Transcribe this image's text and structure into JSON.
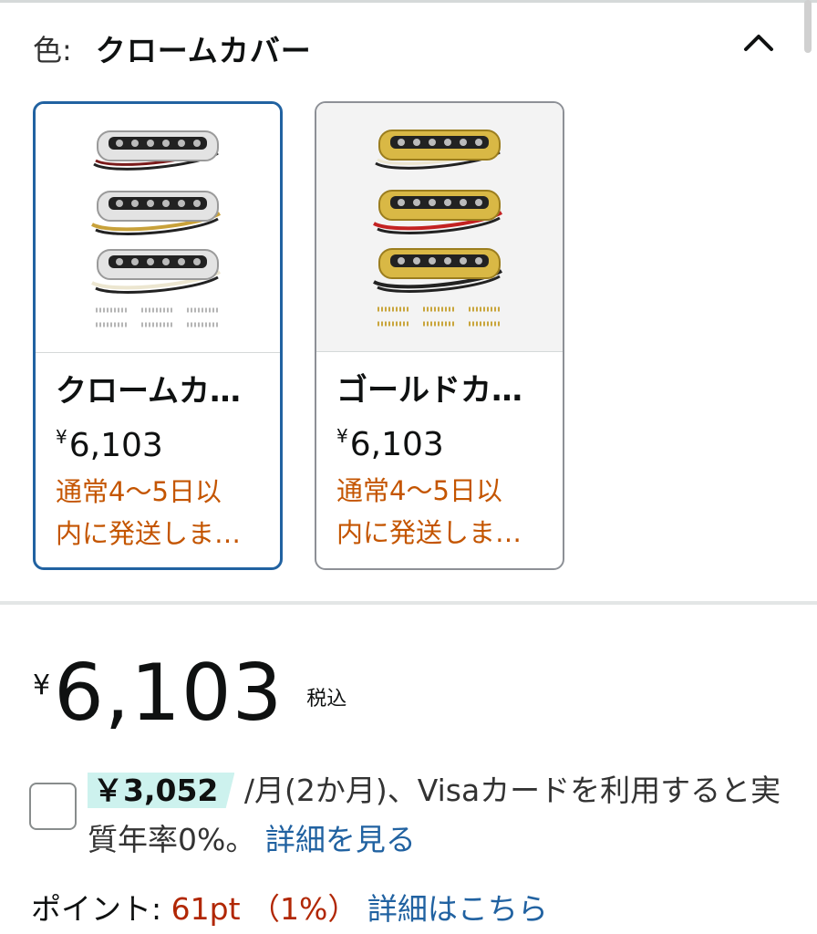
{
  "variation": {
    "label": "色:",
    "selected_value": "クロームカバー",
    "collapse_icon": "chevron-up-icon"
  },
  "options": [
    {
      "title": "クロームカ…",
      "currency": "¥",
      "price": "6,103",
      "shipping_line1": "通常4〜5日以",
      "shipping_line2": "内に発送しま…",
      "selected": true,
      "finish_color": "#e3e3e3"
    },
    {
      "title": "ゴールドカ…",
      "currency": "¥",
      "price": "6,103",
      "shipping_line1": "通常4〜5日以",
      "shipping_line2": "内に発送しま…",
      "selected": false,
      "finish_color": "#d9b845"
    }
  ],
  "price": {
    "currency": "¥",
    "amount": "6,103",
    "tax_note": "税込"
  },
  "installment": {
    "amount": "￥3,052",
    "text_after": "/月(2か月)、Visaカードを利用すると実質年率0%。",
    "link": "詳細を見る"
  },
  "points": {
    "label": "ポイント:",
    "value": "61pt （1%）",
    "link": "詳細はこちら"
  },
  "colors": {
    "selected_border": "#2162a1",
    "shipping_text": "#c45500",
    "points_text": "#b12704",
    "link": "#2162a1",
    "highlight_bg": "#cdf2ee"
  }
}
